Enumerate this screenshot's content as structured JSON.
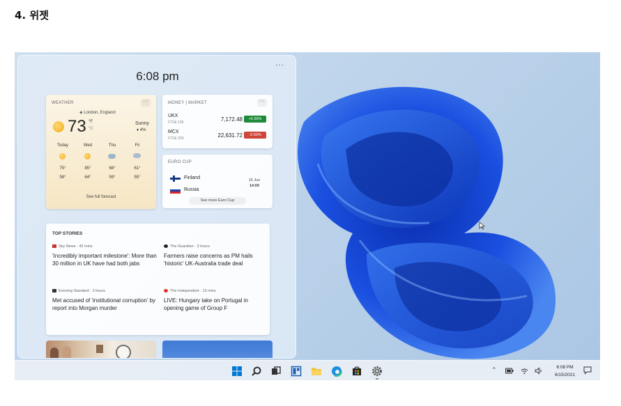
{
  "doc": {
    "heading": "4. 위젯"
  },
  "panel": {
    "time": "6:08 pm",
    "more": "···"
  },
  "weather": {
    "caption": "WEATHER",
    "more": "···",
    "location": "London, England",
    "temperature": "73",
    "unit_f": "°F",
    "unit_c": "°C",
    "condition": "Sunny",
    "precipitation": "4%",
    "forecast": [
      {
        "day": "Today",
        "icon": "sun-icon",
        "high": "75°",
        "low": "58°"
      },
      {
        "day": "Wed",
        "icon": "sun-icon",
        "high": "85°",
        "low": "64°"
      },
      {
        "day": "Thu",
        "icon": "cloud-icon",
        "high": "68°",
        "low": "59°"
      },
      {
        "day": "Fri",
        "icon": "rain-cloud-icon",
        "high": "61°",
        "low": "55°"
      }
    ],
    "full_forecast": "See full forecast"
  },
  "market": {
    "caption": "MONEY | MARKET",
    "more": "···",
    "rows": [
      {
        "ticker": "UKX",
        "index": "FTSE 100",
        "price": "7,172.48",
        "change": "+0.36%",
        "color": "#1e8a3a"
      },
      {
        "ticker": "MCX",
        "index": "FTSE 250",
        "price": "22,631.72",
        "change": "-0.50%",
        "color": "#d0443a"
      }
    ]
  },
  "euro": {
    "caption": "EURO CUP",
    "team1": "Finland",
    "team2": "Russia",
    "date": "16 Jun",
    "time": "14:00",
    "see_more": "See more Euro Cup"
  },
  "stories": {
    "title": "TOP STORIES",
    "items": [
      {
        "source": "Sky News · 43 mins",
        "headline": "'Incredibly important milestone': More than 30 million in UK have had both jabs"
      },
      {
        "source": "The Guardian · 3 hours",
        "headline": "Farmers raise concerns as PM hails 'historic' UK-Australia trade deal"
      },
      {
        "source": "Evening Standard · 3 hours",
        "headline": "Met accused of 'institutional corruption' by report into Morgan murder"
      },
      {
        "source": "The Independent · 13 mins",
        "headline": "LIVE: Hungary take on Portugal in opening game of Group F"
      }
    ]
  },
  "taskbar": {
    "icons": [
      "start-icon",
      "search-icon",
      "task-view-icon",
      "widgets-icon",
      "file-explorer-icon",
      "edge-icon",
      "store-icon",
      "settings-icon"
    ],
    "time": "6:08 PM",
    "date": "6/15/2021",
    "tray_chevron": "^",
    "accent": "#0067c0"
  }
}
